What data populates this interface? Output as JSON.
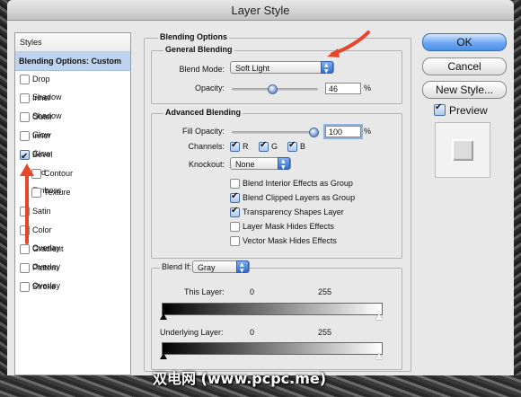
{
  "window": {
    "title": "Layer Style"
  },
  "styles_panel": {
    "header": "Styles",
    "selected": "Blending Options: Custom",
    "items": [
      {
        "label": "Drop Shadow",
        "checked": false
      },
      {
        "label": "Inner Shadow",
        "checked": false
      },
      {
        "label": "Outer Glow",
        "checked": false
      },
      {
        "label": "Inner Glow",
        "checked": false
      },
      {
        "label": "Bevel and Emboss",
        "checked": true
      },
      {
        "label": "Contour",
        "checked": false
      },
      {
        "label": "Texture",
        "checked": false
      },
      {
        "label": "Satin",
        "checked": false
      },
      {
        "label": "Color Overlay",
        "checked": false
      },
      {
        "label": "Gradient Overlay",
        "checked": false
      },
      {
        "label": "Pattern Overlay",
        "checked": false
      },
      {
        "label": "Stroke",
        "checked": false
      }
    ]
  },
  "blending_options": {
    "title": "Blending Options",
    "general": {
      "title": "General Blending",
      "blend_mode_label": "Blend Mode:",
      "blend_mode_value": "Soft Light",
      "opacity_label": "Opacity:",
      "opacity_value": "46",
      "opacity_unit": "%",
      "opacity_level": 0.46
    },
    "advanced": {
      "title": "Advanced Blending",
      "fill_opacity_label": "Fill Opacity:",
      "fill_opacity_value": "100",
      "fill_opacity_unit": "%",
      "fill_opacity_level": 1.0,
      "channels_label": "Channels:",
      "channels": [
        "R",
        "G",
        "B"
      ],
      "knockout_label": "Knockout:",
      "knockout_value": "None",
      "options": [
        {
          "label": "Blend Interior Effects as Group",
          "checked": false
        },
        {
          "label": "Blend Clipped Layers as Group",
          "checked": true
        },
        {
          "label": "Transparency Shapes Layer",
          "checked": true
        },
        {
          "label": "Layer Mask Hides Effects",
          "checked": false
        },
        {
          "label": "Vector Mask Hides Effects",
          "checked": false
        }
      ]
    },
    "blend_if": {
      "label": "Blend If:",
      "value": "Gray",
      "this_layer_label": "This Layer:",
      "this_layer_min": "0",
      "this_layer_max": "255",
      "underlying_label": "Underlying Layer:",
      "underlying_min": "0",
      "underlying_max": "255"
    }
  },
  "buttons": {
    "ok": "OK",
    "cancel": "Cancel",
    "new_style": "New Style...",
    "preview_label": "Preview",
    "preview_checked": true
  },
  "watermark": "双电网 (www.pcpc.me)",
  "colors": {
    "accent": "#3d7fe0",
    "annotation_arrow": "#e8462a",
    "selection": "#bdd3ef"
  }
}
